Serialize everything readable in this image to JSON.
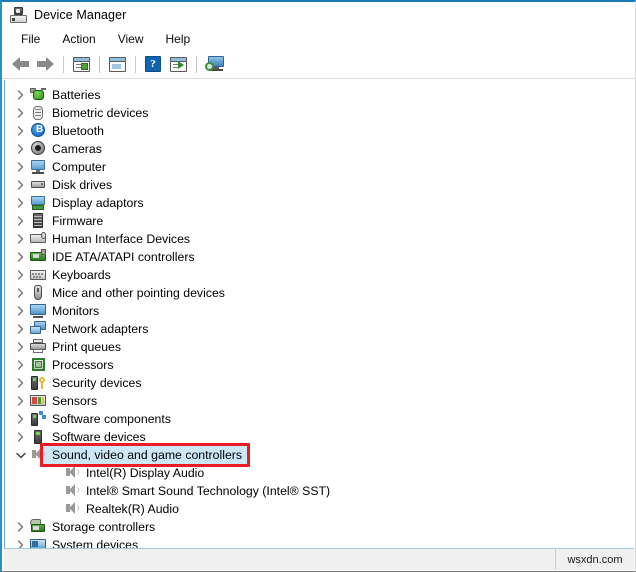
{
  "window": {
    "title": "Device Manager",
    "title_icon": "device-manager-icon"
  },
  "menu": {
    "items": [
      {
        "label": "File"
      },
      {
        "label": "Action"
      },
      {
        "label": "View"
      },
      {
        "label": "Help"
      }
    ]
  },
  "toolbar": {
    "buttons": [
      {
        "name": "back-button",
        "icon": "arrow-left-icon"
      },
      {
        "name": "forward-button",
        "icon": "arrow-right-icon"
      },
      {
        "name": "properties-button",
        "icon": "properties-panel-icon"
      },
      {
        "name": "show-hide-console-tree-button",
        "icon": "console-tree-icon"
      },
      {
        "name": "help-button",
        "icon": "question-mark-icon"
      },
      {
        "name": "update-driver-button",
        "icon": "update-driver-icon"
      },
      {
        "name": "scan-hardware-changes-button",
        "icon": "scan-monitor-icon"
      }
    ]
  },
  "tree": {
    "nodes": [
      {
        "label": "Batteries",
        "icon": "battery-icon",
        "expandable": true,
        "expanded": false,
        "level": 0
      },
      {
        "label": "Biometric devices",
        "icon": "fingerprint-icon",
        "expandable": true,
        "expanded": false,
        "level": 0
      },
      {
        "label": "Bluetooth",
        "icon": "bluetooth-icon",
        "expandable": true,
        "expanded": false,
        "level": 0
      },
      {
        "label": "Cameras",
        "icon": "camera-icon",
        "expandable": true,
        "expanded": false,
        "level": 0
      },
      {
        "label": "Computer",
        "icon": "computer-icon",
        "expandable": true,
        "expanded": false,
        "level": 0
      },
      {
        "label": "Disk drives",
        "icon": "disk-drive-icon",
        "expandable": true,
        "expanded": false,
        "level": 0
      },
      {
        "label": "Display adaptors",
        "icon": "display-adapter-icon",
        "expandable": true,
        "expanded": false,
        "level": 0
      },
      {
        "label": "Firmware",
        "icon": "firmware-chip-icon",
        "expandable": true,
        "expanded": false,
        "level": 0
      },
      {
        "label": "Human Interface Devices",
        "icon": "human-interface-icon",
        "expandable": true,
        "expanded": false,
        "level": 0
      },
      {
        "label": "IDE ATA/ATAPI controllers",
        "icon": "ide-controller-icon",
        "expandable": true,
        "expanded": false,
        "level": 0
      },
      {
        "label": "Keyboards",
        "icon": "keyboard-icon",
        "expandable": true,
        "expanded": false,
        "level": 0
      },
      {
        "label": "Mice and other pointing devices",
        "icon": "mouse-icon",
        "expandable": true,
        "expanded": false,
        "level": 0
      },
      {
        "label": "Monitors",
        "icon": "monitor-icon",
        "expandable": true,
        "expanded": false,
        "level": 0
      },
      {
        "label": "Network adapters",
        "icon": "network-adapter-icon",
        "expandable": true,
        "expanded": false,
        "level": 0
      },
      {
        "label": "Print queues",
        "icon": "printer-icon",
        "expandable": true,
        "expanded": false,
        "level": 0
      },
      {
        "label": "Processors",
        "icon": "processor-icon",
        "expandable": true,
        "expanded": false,
        "level": 0
      },
      {
        "label": "Security devices",
        "icon": "security-device-icon",
        "expandable": true,
        "expanded": false,
        "level": 0
      },
      {
        "label": "Sensors",
        "icon": "sensor-icon",
        "expandable": true,
        "expanded": false,
        "level": 0
      },
      {
        "label": "Software components",
        "icon": "software-component-icon",
        "expandable": true,
        "expanded": false,
        "level": 0
      },
      {
        "label": "Software devices",
        "icon": "software-device-icon",
        "expandable": true,
        "expanded": false,
        "level": 0
      },
      {
        "label": "Sound, video and game controllers",
        "icon": "speaker-icon",
        "expandable": true,
        "expanded": true,
        "level": 0,
        "selected": true,
        "highlighted": true
      },
      {
        "label": "Intel(R) Display Audio",
        "icon": "speaker-icon",
        "expandable": false,
        "expanded": false,
        "level": 1
      },
      {
        "label": "Intel® Smart Sound Technology (Intel® SST)",
        "icon": "speaker-icon",
        "expandable": false,
        "expanded": false,
        "level": 1
      },
      {
        "label": "Realtek(R) Audio",
        "icon": "speaker-icon",
        "expandable": false,
        "expanded": false,
        "level": 1
      },
      {
        "label": "Storage controllers",
        "icon": "storage-controller-icon",
        "expandable": true,
        "expanded": false,
        "level": 0
      },
      {
        "label": "System devices",
        "icon": "system-device-icon",
        "expandable": true,
        "expanded": false,
        "level": 0
      }
    ]
  },
  "annotation": {
    "color": "#ec1c24",
    "target": "Sound, video and game controllers"
  },
  "statusbar": {
    "main_text": "",
    "watermark": "wsxdn.com"
  },
  "colors": {
    "selection": "#cce8f8",
    "accent": "#1a7bb9",
    "annotation": "#ec1c24"
  }
}
